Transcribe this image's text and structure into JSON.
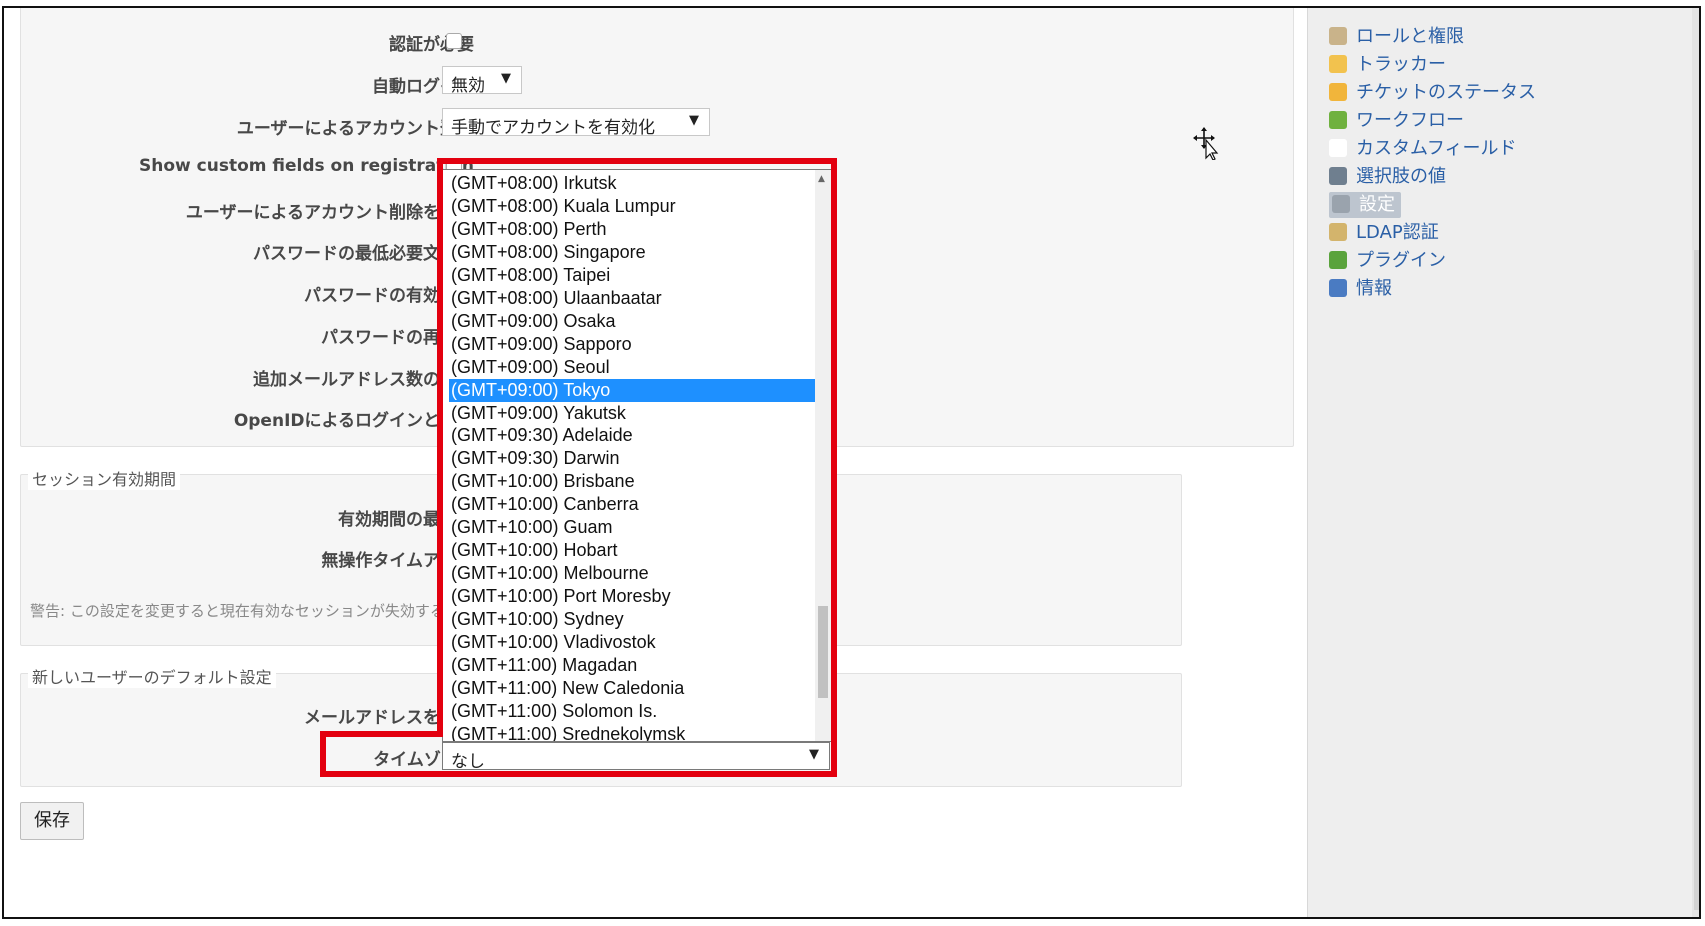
{
  "settings": {
    "auth_required_label": "認証が必要",
    "autologin_label": "自動ログイン",
    "autologin_value": "無効",
    "self_registration_label": "ユーザーによるアカウント登録",
    "self_registration_value": "手動でアカウントを有効化",
    "show_custom_fields_label": "Show custom fields on registration",
    "allow_account_delete_label": "ユーザーによるアカウント削除を許可",
    "password_min_length_label": "パスワードの最低必要文字数",
    "password_max_age_label": "パスワードの有効期限",
    "lost_password_label": "パスワードの再発行",
    "max_additional_emails_label": "追加メールアドレス数の上限",
    "openid_label": "OpenIDによるログインと登録"
  },
  "session": {
    "legend": "セッション有効期間",
    "lifetime_label": "有効期間の最大値",
    "timeout_label": "無操作タイムアウト",
    "warning": "警告: この設定を変更すると現在有効なセッションが失効する"
  },
  "new_user_defaults": {
    "legend": "新しいユーザーのデフォルト設定",
    "hide_mail_label": "メールアドレスを隠す",
    "timezone_label": "タイムゾーン",
    "timezone_value": "なし"
  },
  "timezone_options": [
    "(GMT+08:00) Irkutsk",
    "(GMT+08:00) Kuala Lumpur",
    "(GMT+08:00) Perth",
    "(GMT+08:00) Singapore",
    "(GMT+08:00) Taipei",
    "(GMT+08:00) Ulaanbaatar",
    "(GMT+09:00) Osaka",
    "(GMT+09:00) Sapporo",
    "(GMT+09:00) Seoul",
    "(GMT+09:00) Tokyo",
    "(GMT+09:00) Yakutsk",
    "(GMT+09:30) Adelaide",
    "(GMT+09:30) Darwin",
    "(GMT+10:00) Brisbane",
    "(GMT+10:00) Canberra",
    "(GMT+10:00) Guam",
    "(GMT+10:00) Hobart",
    "(GMT+10:00) Melbourne",
    "(GMT+10:00) Port Moresby",
    "(GMT+10:00) Sydney",
    "(GMT+10:00) Vladivostok",
    "(GMT+11:00) Magadan",
    "(GMT+11:00) New Caledonia",
    "(GMT+11:00) Solomon Is.",
    "(GMT+11:00) Srednekolymsk"
  ],
  "timezone_selected": "(GMT+09:00) Tokyo",
  "save_label": "保存",
  "admin_menu": {
    "items": [
      {
        "label": "ロールと権限",
        "icon": "roles-icon",
        "color": "#c9b38a"
      },
      {
        "label": "トラッカー",
        "icon": "trackers-icon",
        "color": "#f2c24e"
      },
      {
        "label": "チケットのステータス",
        "icon": "issue-status-icon",
        "color": "#f1b53b"
      },
      {
        "label": "ワークフロー",
        "icon": "workflow-icon",
        "color": "#6fb13f"
      },
      {
        "label": "カスタムフィールド",
        "icon": "custom-fields-icon",
        "color": "#ffffff"
      },
      {
        "label": "選択肢の値",
        "icon": "enumerations-icon",
        "color": "#6f7f8f"
      },
      {
        "label": "設定",
        "icon": "settings-icon",
        "color": "#9aa3ad"
      },
      {
        "label": "LDAP認証",
        "icon": "ldap-icon",
        "color": "#d3b46c"
      },
      {
        "label": "プラグイン",
        "icon": "plugins-icon",
        "color": "#5aa33c"
      },
      {
        "label": "情報",
        "icon": "info-icon",
        "color": "#4a7bc2"
      }
    ],
    "active": "設定"
  },
  "colors": {
    "highlight": "#e3000f",
    "selected_option": "#1e90ff",
    "link": "#2a5fa6"
  }
}
